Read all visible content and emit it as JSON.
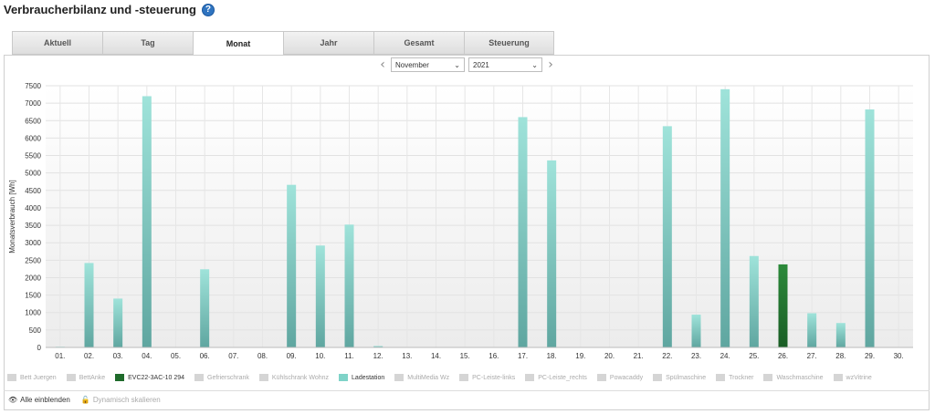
{
  "header": {
    "title": "Verbraucherbilanz und -steuerung",
    "help_icon": "?"
  },
  "tabs": [
    {
      "label": "Aktuell",
      "active": false
    },
    {
      "label": "Tag",
      "active": false
    },
    {
      "label": "Monat",
      "active": true
    },
    {
      "label": "Jahr",
      "active": false
    },
    {
      "label": "Gesamt",
      "active": false
    },
    {
      "label": "Steuerung",
      "active": false
    }
  ],
  "period": {
    "month": "November",
    "year": "2021",
    "prev_icon": "‹",
    "next_icon": "›",
    "dropdown_icon": "⌄"
  },
  "chart_data": {
    "type": "bar",
    "ylabel": "Monatsverbrauch [Wh]",
    "ylim": [
      0,
      7500
    ],
    "yticks": [
      0,
      500,
      1000,
      1500,
      2000,
      2500,
      3000,
      3500,
      4000,
      4500,
      5000,
      5500,
      6000,
      6500,
      7000,
      7500
    ],
    "categories": [
      "01.",
      "02.",
      "03.",
      "04.",
      "05.",
      "06.",
      "07.",
      "08.",
      "09.",
      "10.",
      "11.",
      "12.",
      "13.",
      "14.",
      "15.",
      "16.",
      "17.",
      "18.",
      "19.",
      "20.",
      "21.",
      "22.",
      "23.",
      "24.",
      "25.",
      "26.",
      "27.",
      "28.",
      "29.",
      "30."
    ],
    "series": [
      {
        "name": "Ladestation",
        "color": "#7fd3c8",
        "values": [
          20,
          2420,
          1400,
          7200,
          0,
          2240,
          0,
          0,
          4660,
          2920,
          3520,
          40,
          0,
          0,
          0,
          0,
          6600,
          5360,
          0,
          0,
          0,
          6340,
          940,
          7400,
          2620,
          0,
          980,
          700,
          6820,
          0
        ]
      },
      {
        "name": "EVC22-3AC-10 294",
        "color": "#1f6b2b",
        "values": [
          0,
          0,
          0,
          0,
          0,
          0,
          0,
          0,
          0,
          0,
          0,
          0,
          0,
          0,
          0,
          0,
          0,
          0,
          0,
          0,
          0,
          0,
          0,
          0,
          0,
          2380,
          0,
          0,
          0,
          0
        ]
      }
    ]
  },
  "legend": [
    {
      "label": "Bett Juergen",
      "color": "#d5d5d5",
      "on": false
    },
    {
      "label": "BettAnke",
      "color": "#d5d5d5",
      "on": false
    },
    {
      "label": "EVC22-3AC-10 294",
      "color": "#1f6b2b",
      "on": true
    },
    {
      "label": "Gefrierschrank",
      "color": "#d5d5d5",
      "on": false
    },
    {
      "label": "Kühlschrank Wohnz",
      "color": "#d5d5d5",
      "on": false
    },
    {
      "label": "Ladestation",
      "color": "#7fd3c8",
      "on": true
    },
    {
      "label": "MultiMedia Wz",
      "color": "#d5d5d5",
      "on": false
    },
    {
      "label": "PC-Leiste-links",
      "color": "#d5d5d5",
      "on": false
    },
    {
      "label": "PC-Leiste_rechts",
      "color": "#d5d5d5",
      "on": false
    },
    {
      "label": "Powacaddy",
      "color": "#d5d5d5",
      "on": false
    },
    {
      "label": "Spülmaschine",
      "color": "#d5d5d5",
      "on": false
    },
    {
      "label": "Trockner",
      "color": "#d5d5d5",
      "on": false
    },
    {
      "label": "Waschmaschine",
      "color": "#d5d5d5",
      "on": false
    },
    {
      "label": "wzVitrine",
      "color": "#d5d5d5",
      "on": false
    }
  ],
  "actions": {
    "show_all": {
      "label": "Alle einblenden",
      "icon": "eye-icon"
    },
    "dynamic_scale": {
      "label": "Dynamisch skalieren",
      "icon": "lock-icon"
    }
  }
}
